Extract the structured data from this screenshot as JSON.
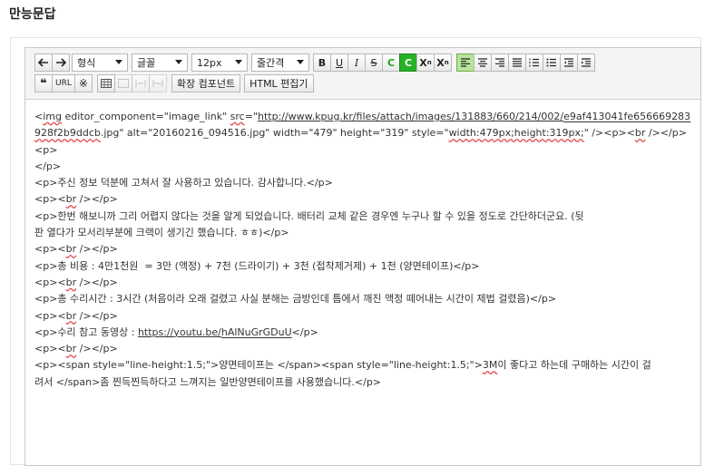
{
  "page_title": "만능문답",
  "toolbar": {
    "undo_label": "←",
    "redo_label": "→",
    "format_select": "형식",
    "font_select": "글꼴",
    "size_select": "12px",
    "lineheight_select": "줄간격",
    "bold": "B",
    "underline": "U",
    "italic": "I",
    "strike": "S",
    "font_color": "C",
    "bg_color": "C",
    "superscript": "X",
    "sup_mark": "n",
    "subscript": "X",
    "sub_mark": "n",
    "quote": "❝",
    "url": "URL",
    "special_char": "※",
    "extension_component": "확장 컴포넌트",
    "html_editor": "HTML 편집기"
  },
  "content_lines": [
    [
      {
        "t": "<"
      },
      {
        "t": "img",
        "u": 1
      },
      {
        "t": " editor_component=\"image_link\" "
      },
      {
        "t": "src",
        "u": 1
      },
      {
        "t": "=\""
      },
      {
        "t": "http://www.kpug.kr/files/attach/images/131883/660/214/002/",
        "l": 1
      },
      {
        "t": "e9af413041fe656669283",
        "l": 1,
        "u": 1
      }
    ],
    [
      {
        "t": "928f2b9ddcb",
        "u": 1
      },
      {
        "t": ".jpg\" alt=\"20160216_094516.jpg\" width=\"479\" height=\"319\" style=\""
      },
      {
        "t": "width:479px;height:319px;",
        "u": 1
      },
      {
        "t": "\" /><p><"
      },
      {
        "t": "br",
        "u": 1
      },
      {
        "t": " /></p>"
      }
    ],
    [
      {
        "t": "<p>"
      }
    ],
    [
      {
        "t": "</p>"
      }
    ],
    [
      {
        "t": "<p>주신 정보 덕분에 고쳐서 잘 사용하고 있습니다. 감사합니다.</p>"
      }
    ],
    [
      {
        "t": "<p><"
      },
      {
        "t": "br",
        "u": 1
      },
      {
        "t": " /></p>"
      }
    ],
    [
      {
        "t": "<p>한번 해보니까 그리 어렵지 않다는 것을 알게 되었습니다. 배터리 교체 같은 경우엔 누구나 할 수 있을 정도로 간단하더군요. (뒷"
      }
    ],
    [
      {
        "t": "판 열다가 모서리부분에 크랙이 생기긴 했습니다. ㅎㅎ)</p>"
      }
    ],
    [
      {
        "t": "<p><"
      },
      {
        "t": "br",
        "u": 1
      },
      {
        "t": " /></p>"
      }
    ],
    [
      {
        "t": "<p>총 비용 : 4만1천원  = 3만 (액정) + 7천 (드라이기) + 3천 (접착제거제) + 1천 (양면테이프)</p>"
      }
    ],
    [
      {
        "t": "<p><"
      },
      {
        "t": "br",
        "u": 1
      },
      {
        "t": " /></p>"
      }
    ],
    [
      {
        "t": "<p>총 수리시간 : 3시간 (처음이라 오래 걸렸고 사실 분해는 금방인데 틈에서 깨진 액정 떼어내는 시간이 제법 걸렸음)</p>"
      }
    ],
    [
      {
        "t": "<p><"
      },
      {
        "t": "br",
        "u": 1
      },
      {
        "t": " /></p>"
      }
    ],
    [
      {
        "t": "<p>수리 참고 동영상 : "
      },
      {
        "t": "https://youtu.be/",
        "l": 1
      },
      {
        "t": "hAlNuGrGDuU",
        "l": 1,
        "u": 1
      },
      {
        "t": "</p>"
      }
    ],
    [
      {
        "t": "<p><"
      },
      {
        "t": "br",
        "u": 1
      },
      {
        "t": " /></p>"
      }
    ],
    [
      {
        "t": "<p><span style=\"line-height:1.5;\">양면테이프는 </span><span style=\"line-height:1.5;\">"
      },
      {
        "t": "3M",
        "u": 1
      },
      {
        "t": "이 좋다고 하는데 구매하는 시간이 걸"
      }
    ],
    [
      {
        "t": "려서 </span>좀 찐득찐득하다고 느껴지는 일반양면테이프를 사용했습니다.</p>"
      }
    ]
  ]
}
